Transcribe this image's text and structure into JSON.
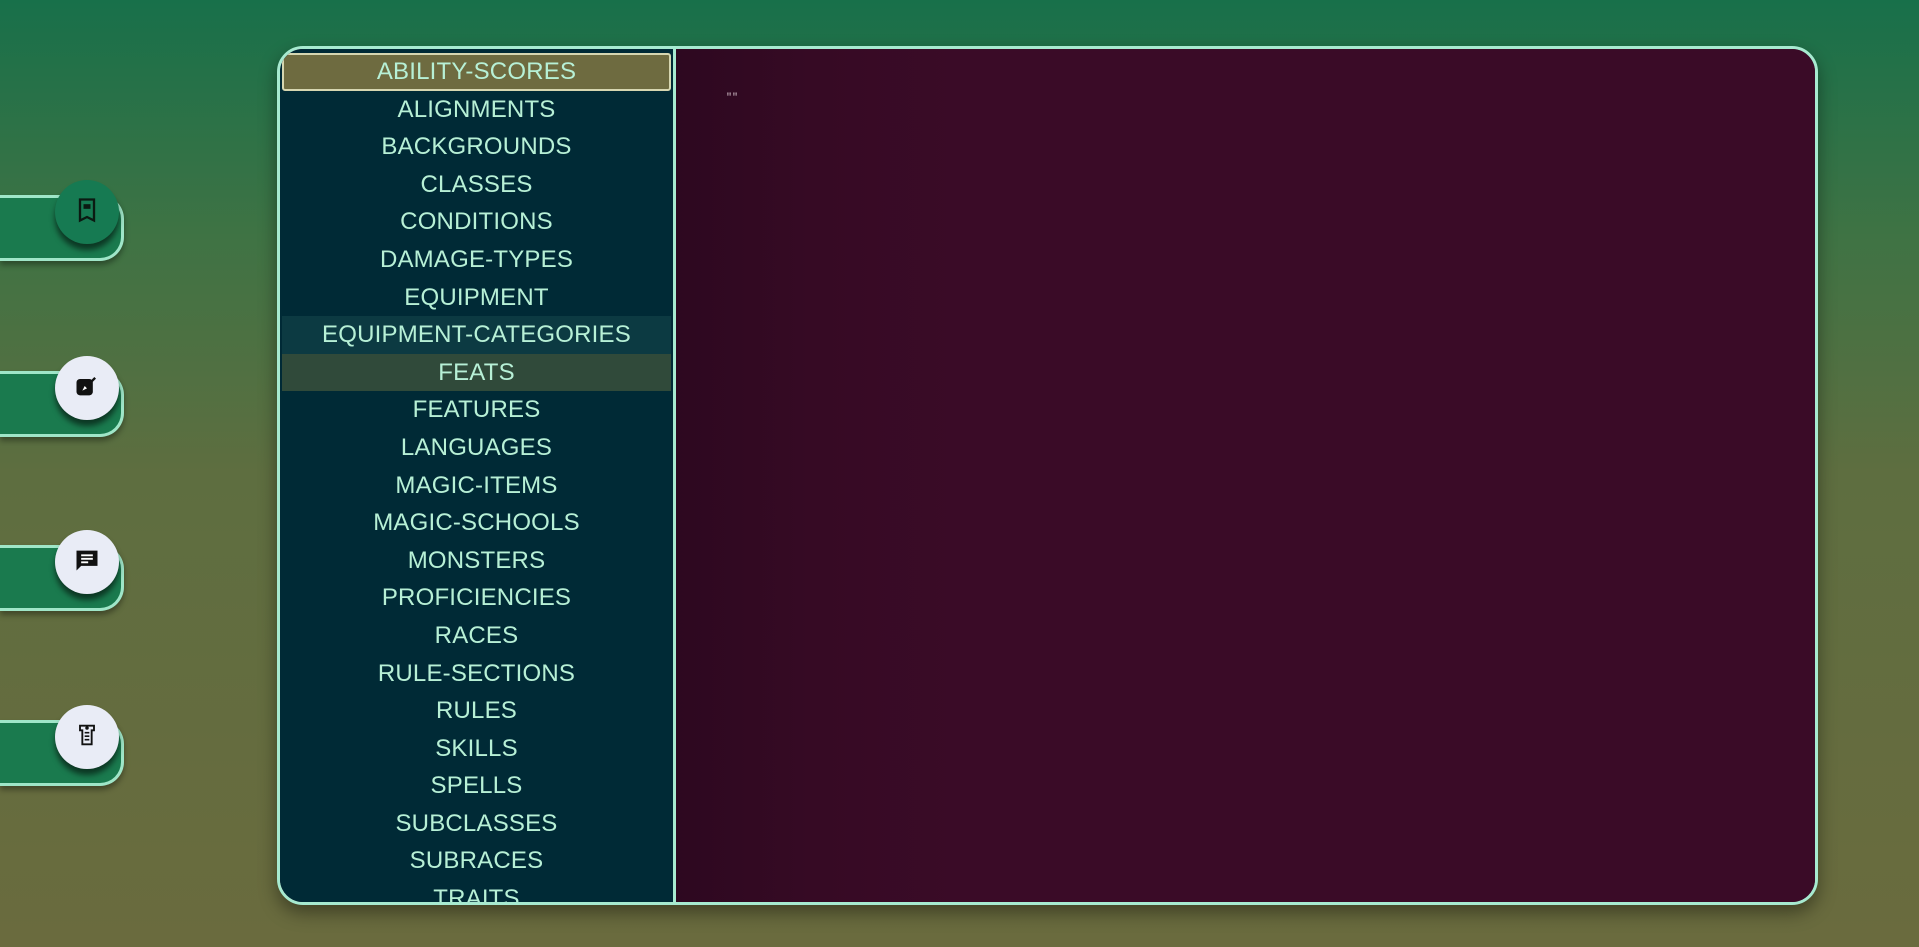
{
  "side_nav": [
    {
      "name": "book-icon",
      "state": "active"
    },
    {
      "name": "edit-icon",
      "state": "inactive"
    },
    {
      "name": "chat-icon",
      "state": "inactive"
    },
    {
      "name": "scroll-icon",
      "state": "inactive"
    }
  ],
  "menu": {
    "items": [
      "ABILITY-SCORES",
      "ALIGNMENTS",
      "BACKGROUNDS",
      "CLASSES",
      "CONDITIONS",
      "DAMAGE-TYPES",
      "EQUIPMENT",
      "EQUIPMENT-CATEGORIES",
      "FEATS",
      "FEATURES",
      "LANGUAGES",
      "MAGIC-ITEMS",
      "MAGIC-SCHOOLS",
      "MONSTERS",
      "PROFICIENCIES",
      "RACES",
      "RULE-SECTIONS",
      "RULES",
      "SKILLS",
      "SPELLS",
      "SUBCLASSES",
      "SUBRACES",
      "TRAITS"
    ],
    "selected": "ABILITY-SCORES",
    "hovered": "EQUIPMENT-CATEGORIES",
    "focused": "FEATS"
  },
  "content": {
    "text": "\"\""
  },
  "colors": {
    "accent": "#a7ead0",
    "menu_bg": "#002a36",
    "content_bg": "#3a0b27",
    "menu_text": "#b7f0d6",
    "selected_bg": "#6e6b40"
  }
}
